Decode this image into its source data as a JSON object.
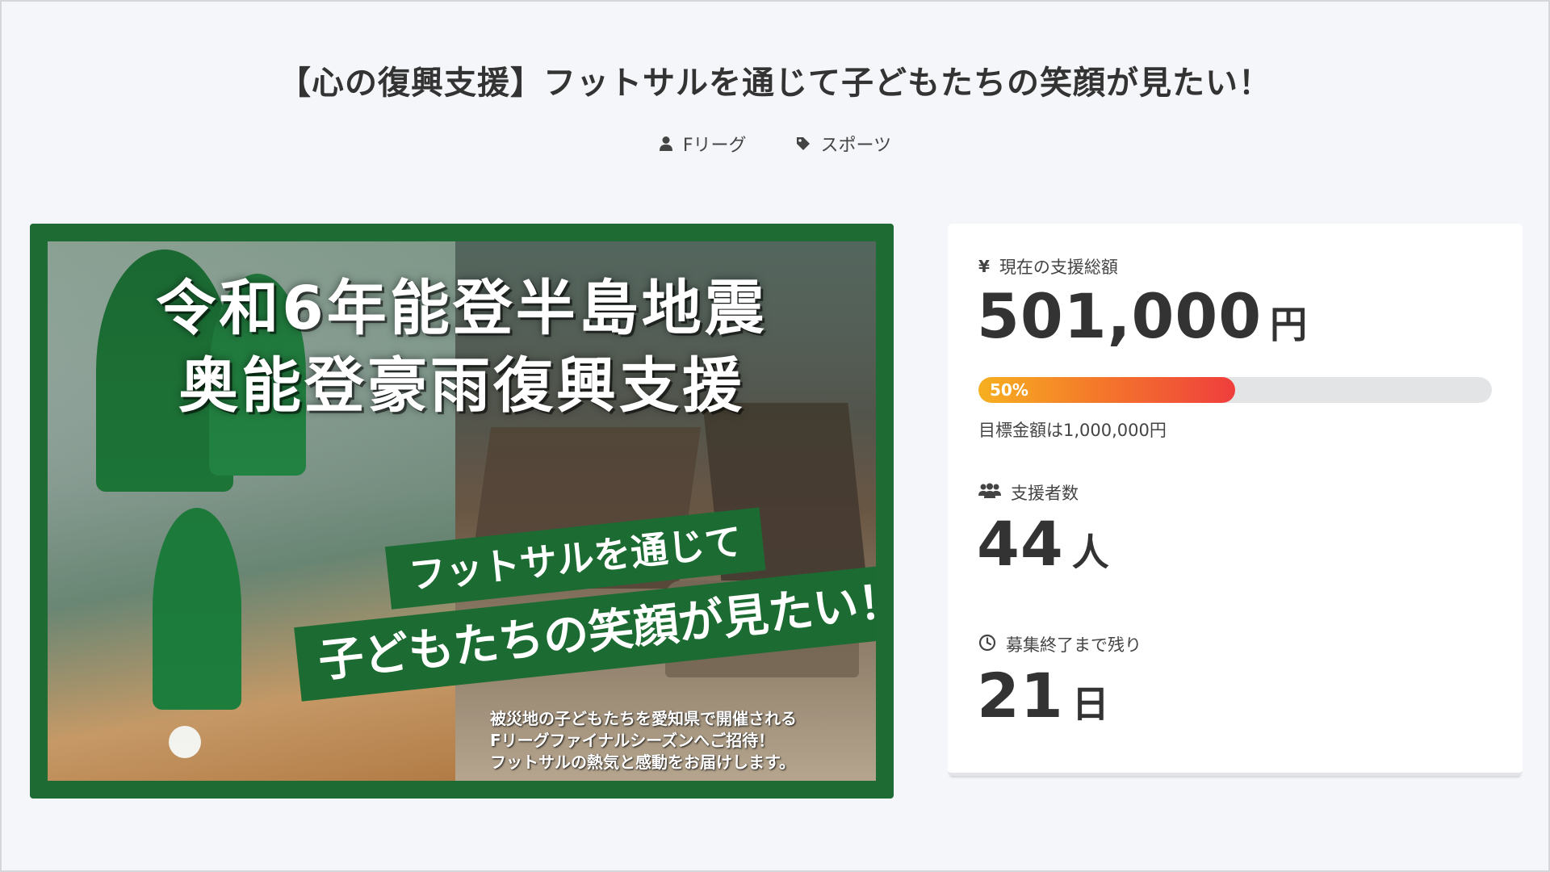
{
  "project": {
    "title": "【心の復興支援】フットサルを通じて子どもたちの笑顔が見たい！",
    "owner": "Fリーグ",
    "category": "スポーツ",
    "icons": {
      "owner": "user-icon",
      "category": "tag-icon"
    }
  },
  "banner": {
    "headline_line1": "令和6年能登半島地震",
    "headline_line2": "奥能登豪雨復興支援",
    "strip_line1": "フットサルを通じて",
    "strip_line2": "子どもたちの笑顔が見たい！",
    "caption_line1": "被災地の子どもたちを愛知県で開催される",
    "caption_line2": "Fリーグファイナルシーズンへご招待！",
    "caption_line3": "フットサルの熱気と感動をお届けします。",
    "colors": {
      "frame": "#1f6b34",
      "strip": "#1c6b32"
    }
  },
  "stats": {
    "total": {
      "icon": "yen-icon",
      "label": "現在の支援総額",
      "value": "501,000",
      "unit": "円"
    },
    "progress": {
      "percent": 50,
      "label": "50%",
      "goal_text": "目標金額は1,000,000円"
    },
    "supporters": {
      "icon": "users-icon",
      "label": "支援者数",
      "value": "44",
      "unit": "人"
    },
    "remaining": {
      "icon": "clock-icon",
      "label": "募集終了まで残り",
      "value": "21",
      "unit": "日"
    },
    "colors": {
      "progress_start": "#f6b020",
      "progress_end": "#ef3e3d",
      "progress_track": "#e3e4e6"
    }
  }
}
